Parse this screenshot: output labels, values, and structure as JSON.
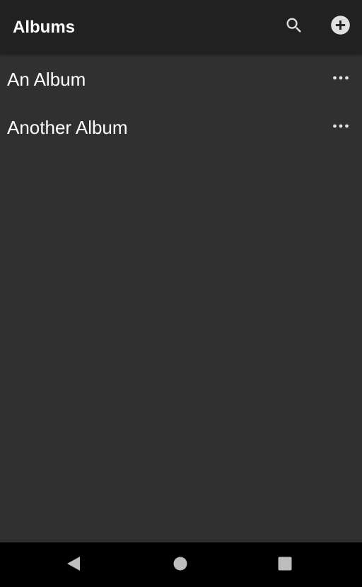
{
  "app_bar": {
    "title": "Albums",
    "search_icon": "search-icon",
    "add_icon": "add-circle-icon"
  },
  "albums": [
    {
      "label": "An Album",
      "menu_icon": "more-horizontal-icon"
    },
    {
      "label": "Another Album",
      "menu_icon": "more-horizontal-icon"
    }
  ],
  "nav_bar": {
    "back_icon": "back-triangle-icon",
    "home_icon": "home-circle-icon",
    "recents_icon": "recents-square-icon"
  },
  "colors": {
    "background": "#303030",
    "app_bar": "#212121",
    "nav_bar": "#000000",
    "text": "#ffffff",
    "icon": "#e0e0e0",
    "nav_icon": "#bdbdbd"
  }
}
